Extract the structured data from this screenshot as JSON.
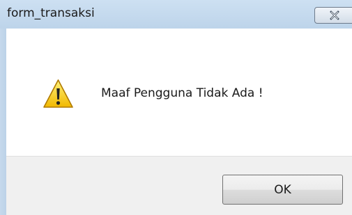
{
  "window": {
    "title": "form_transaksi"
  },
  "icons": {
    "close": "close-x-icon",
    "message": "warning-icon"
  },
  "message": {
    "text": "Maaf Pengguna Tidak Ada !"
  },
  "buttons": {
    "ok_label": "OK"
  },
  "colors": {
    "titlebar": "#c6dbef",
    "footer": "#f0f0f0",
    "warning_yellow": "#f3c300"
  }
}
